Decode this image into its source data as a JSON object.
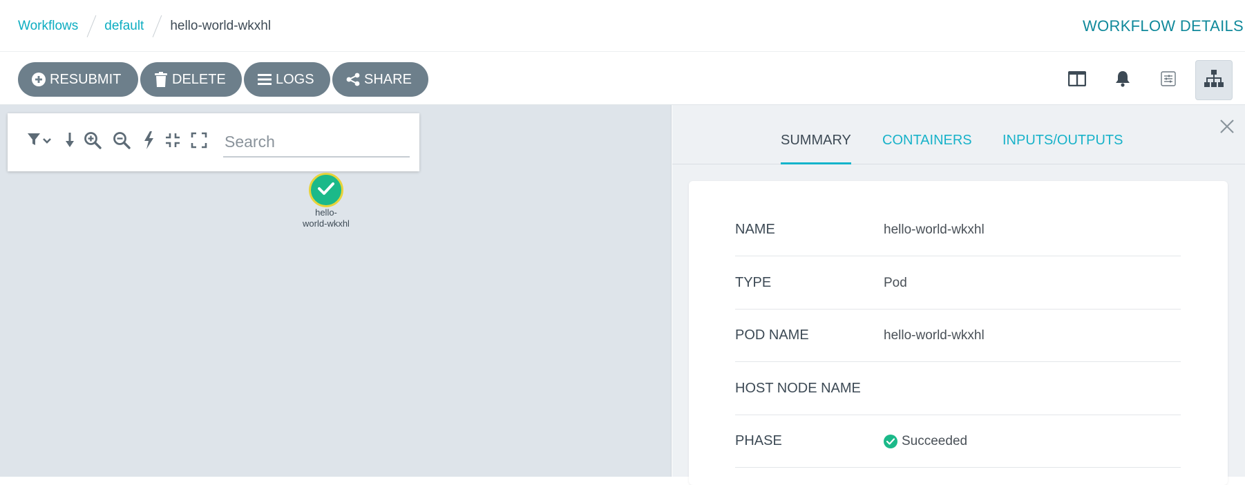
{
  "breadcrumb": {
    "items": [
      "Workflows",
      "default"
    ],
    "current": "hello-world-wkxhl"
  },
  "page_title": "WORKFLOW DETAILS",
  "toolbar": {
    "resubmit_label": "RESUBMIT",
    "delete_label": "DELETE",
    "logs_label": "LOGS",
    "share_label": "SHARE",
    "right_icons": [
      "columns-icon",
      "bell-icon",
      "sliders-icon",
      "sitemap-icon"
    ],
    "active_view": "sitemap-icon"
  },
  "graph": {
    "toolbar_icons": [
      "filter-icon",
      "download-icon",
      "zoom-in-icon",
      "zoom-out-icon",
      "bolt-icon",
      "compress-icon",
      "expand-icon"
    ],
    "search_placeholder": "Search",
    "node": {
      "label_line1": "hello-",
      "label_line2": "world-wkxhl",
      "status_color": "#1bb989",
      "ring_color": "#e7d33a"
    }
  },
  "panel": {
    "tabs": [
      {
        "label": "SUMMARY",
        "active": true
      },
      {
        "label": "CONTAINERS",
        "active": false
      },
      {
        "label": "INPUTS/OUTPUTS",
        "active": false
      }
    ],
    "summary": [
      {
        "label": "NAME",
        "value": "hello-world-wkxhl"
      },
      {
        "label": "TYPE",
        "value": "Pod"
      },
      {
        "label": "POD NAME",
        "value": "hello-world-wkxhl"
      },
      {
        "label": "HOST NODE NAME",
        "value": ""
      },
      {
        "label": "PHASE",
        "value": "Succeeded"
      }
    ]
  },
  "colors": {
    "accent": "#0dadc1",
    "button": "#6d7f8b",
    "success": "#1bb989",
    "canvas": "#dee4ea"
  }
}
